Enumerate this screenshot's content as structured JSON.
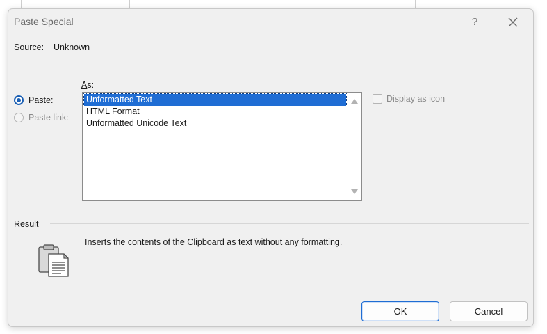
{
  "dialog": {
    "title": "Paste Special",
    "help_icon": "?",
    "close_icon": "close-icon"
  },
  "source": {
    "label": "Source:",
    "value": "Unknown"
  },
  "as_label_first": "A",
  "as_label_rest": "s:",
  "options": {
    "paste_first": "P",
    "paste_rest": "aste:",
    "paste_selected": true,
    "paste_link": "Paste link:",
    "paste_link_enabled": false
  },
  "formats": [
    {
      "label": "Unformatted Text",
      "selected": true
    },
    {
      "label": "HTML Format",
      "selected": false
    },
    {
      "label": "Unformatted Unicode Text",
      "selected": false
    }
  ],
  "display_as_icon": {
    "label": "Display as icon",
    "checked": false,
    "enabled": false
  },
  "result": {
    "label": "Result",
    "description": "Inserts the contents of the Clipboard as text without any formatting.",
    "icon": "clipboard-text-icon"
  },
  "buttons": {
    "ok": "OK",
    "cancel": "Cancel"
  },
  "colors": {
    "accent": "#1f6dd4",
    "dialog_bg": "#f0f0f0"
  }
}
